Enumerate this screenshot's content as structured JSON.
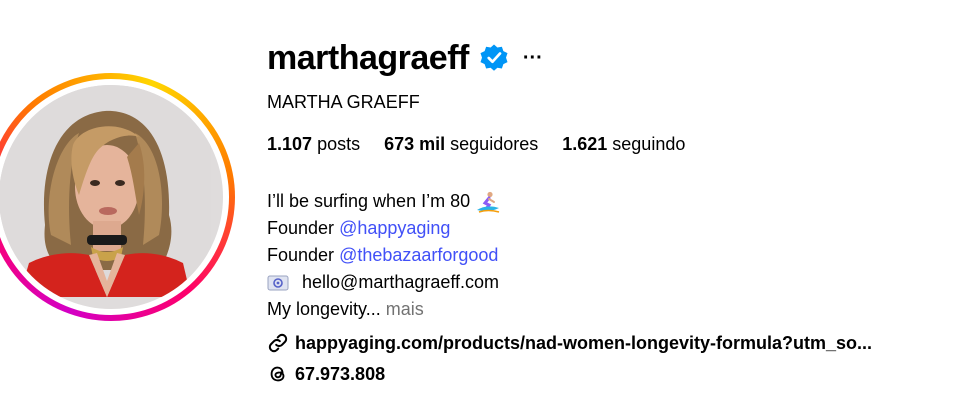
{
  "profile": {
    "username": "marthagraeff",
    "full_name": "MARTHA GRAEFF",
    "more_label": "···"
  },
  "stats": {
    "posts_value": "1.107",
    "posts_label": "posts",
    "followers_value": "673 mil",
    "followers_label": "seguidores",
    "following_value": "1.621",
    "following_label": "seguindo"
  },
  "bio": {
    "line1": "I’ll be surfing when I’m 80",
    "founder1_prefix": "Founder",
    "founder1_mention": "@happyaging",
    "founder2_prefix": "Founder",
    "founder2_mention": "@thebazaarforgood",
    "email": "hello@marthagraeff.com",
    "line_longevity": "My longevity...",
    "more_label": "mais"
  },
  "link": {
    "url": "happyaging.com/products/nad-women-longevity-formula?utm_so..."
  },
  "threads": {
    "count": "67.973.808"
  },
  "colors": {
    "mention": "#4150f7",
    "verified": "#0095f6",
    "muted": "#737373"
  },
  "icons": {
    "verified": "verified-badge-icon",
    "more": "more-options-icon",
    "surf": "surfer-emoji-icon",
    "email": "email-emoji-icon",
    "link": "link-icon",
    "threads": "threads-icon"
  }
}
